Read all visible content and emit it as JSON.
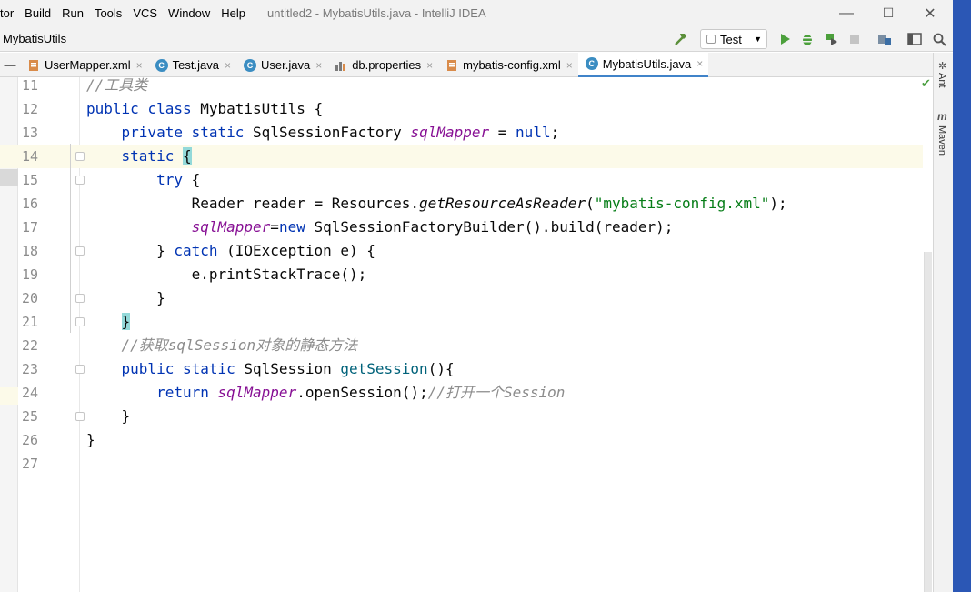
{
  "menu": [
    "tor",
    "Build",
    "Run",
    "Tools",
    "VCS",
    "Window",
    "Help"
  ],
  "window_title": "untitled2 - MybatisUtils.java - IntelliJ IDEA",
  "window_controls": {
    "minimize": "—",
    "maximize": "☐",
    "close": "✕"
  },
  "breadcrumb": "MybatisUtils",
  "run_config": {
    "label": "Test",
    "caret": "▼"
  },
  "toolbar_icons": [
    "hammer-icon",
    "run-icon",
    "debug-icon",
    "coverage-icon",
    "stop-icon",
    "project-structure-icon",
    "layout-icon",
    "search-icon"
  ],
  "tabs": [
    {
      "label": "UserMapper.xml",
      "icon": "xml",
      "active": false
    },
    {
      "label": "Test.java",
      "icon": "class-test",
      "active": false
    },
    {
      "label": "User.java",
      "icon": "class",
      "active": false
    },
    {
      "label": "db.properties",
      "icon": "properties",
      "active": false
    },
    {
      "label": "mybatis-config.xml",
      "icon": "xml",
      "active": false
    },
    {
      "label": "MybatisUtils.java",
      "icon": "class",
      "active": true
    }
  ],
  "tab_close": "×",
  "tab_collapse": "—",
  "right_stripe": {
    "ant": "Ant",
    "maven": "Maven"
  },
  "colors": {
    "keyword": "#0033b3",
    "field": "#871094",
    "method": "#00627a",
    "string": "#067d17",
    "comment": "#8c8c8c",
    "current_line": "#fcfae9",
    "brace_match": "#93d9d9"
  },
  "editor": {
    "current_line": 14,
    "lines": [
      {
        "n": "11",
        "text": "//工具类"
      },
      {
        "n": "12",
        "text": "public class MybatisUtils {"
      },
      {
        "n": "13",
        "text": "    private static SqlSessionFactory sqlMapper = null;"
      },
      {
        "n": "14",
        "text": "    static {"
      },
      {
        "n": "15",
        "text": "        try {"
      },
      {
        "n": "16",
        "text": "            Reader reader = Resources.getResourceAsReader(\"mybatis-config.xml\");"
      },
      {
        "n": "17",
        "text": "            sqlMapper=new SqlSessionFactoryBuilder().build(reader);"
      },
      {
        "n": "18",
        "text": "        } catch (IOException e) {"
      },
      {
        "n": "19",
        "text": "            e.printStackTrace();"
      },
      {
        "n": "20",
        "text": "        }"
      },
      {
        "n": "21",
        "text": "    }"
      },
      {
        "n": "22",
        "text": "    //获取sqlSession对象的静态方法"
      },
      {
        "n": "23",
        "text": "    public static SqlSession getSession(){"
      },
      {
        "n": "24",
        "text": "        return sqlMapper.openSession();//打开一个Session"
      },
      {
        "n": "25",
        "text": "    }"
      },
      {
        "n": "26",
        "text": "}"
      },
      {
        "n": "27",
        "text": ""
      }
    ]
  }
}
